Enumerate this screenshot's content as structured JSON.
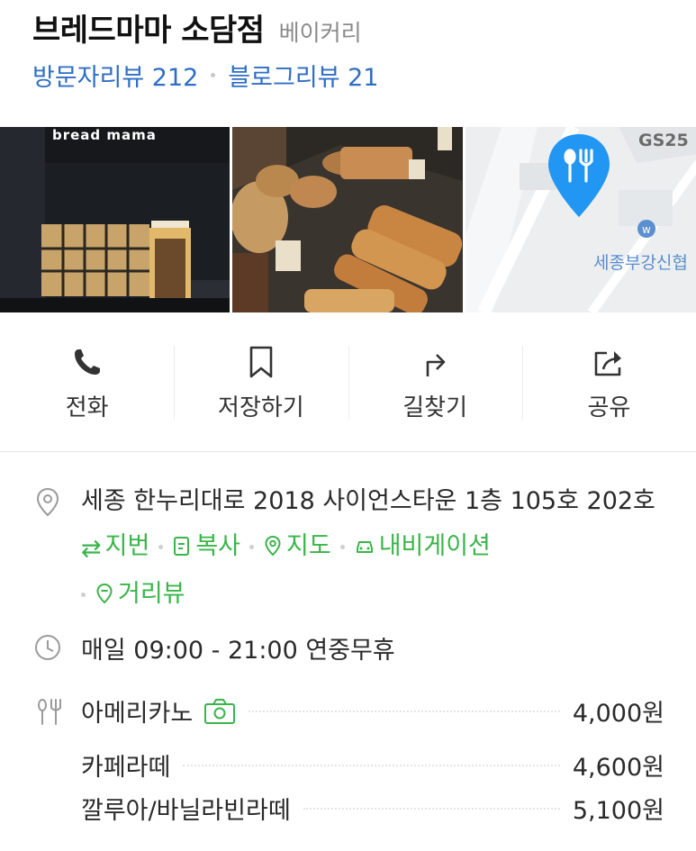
{
  "place": {
    "name": "브레드마마 소담점",
    "category": "베이커리",
    "visitor_reviews": "방문자리뷰 212",
    "blog_reviews": "블로그리뷰 21"
  },
  "photos": {
    "storefront_sign": "bread mama",
    "map_label_store": "GS25",
    "map_label_place": "세종부강신협"
  },
  "actions": [
    {
      "label": "전화",
      "icon": "phone-icon"
    },
    {
      "label": "저장하기",
      "icon": "bookmark-icon"
    },
    {
      "label": "길찾기",
      "icon": "directions-icon"
    },
    {
      "label": "공유",
      "icon": "share-icon"
    }
  ],
  "address": {
    "text": "세종 한누리대로 2018 사이언스타운 1층 105호 202호",
    "links": {
      "jibun": "지번",
      "copy": "복사",
      "map": "지도",
      "navigation": "내비게이션",
      "street_view": "거리뷰"
    }
  },
  "hours": {
    "text": "매일 09:00 - 21:00 연중무휴"
  },
  "menu": [
    {
      "name": "아메리카노",
      "price": "4,000원",
      "has_photo": true
    },
    {
      "name": "카페라떼",
      "price": "4,600원",
      "has_photo": false
    },
    {
      "name": "깔루아/바닐라빈라떼",
      "price": "5,100원",
      "has_photo": false
    }
  ],
  "colors": {
    "link_blue": "#2f6ec4",
    "link_green": "#3ab54a",
    "map_pin": "#2196f3"
  }
}
